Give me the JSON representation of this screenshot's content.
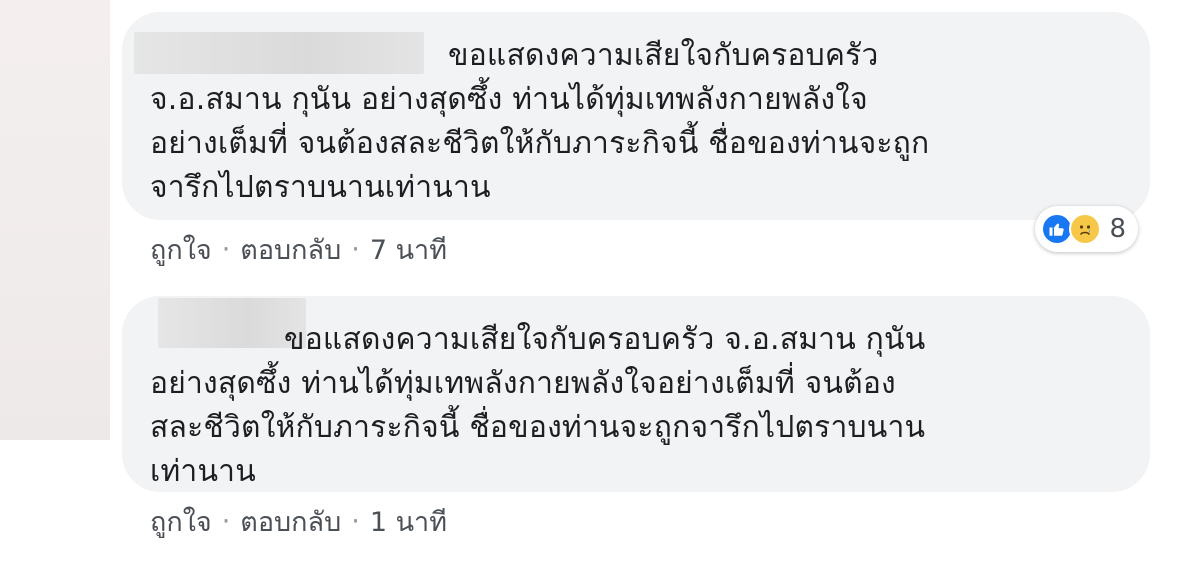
{
  "comments": [
    {
      "author": "",
      "lines": [
        "ขอแสดงความเสียใจกับครอบครัว",
        "จ.อ.สมาน กุนัน อย่างสุดซึ้ง ท่านได้ทุ่มเทพลังกายพลังใจ",
        "อย่างเต็มที่ จนต้องสละชีวิตให้กับภาระกิจนี้ ชื่อของท่านจะถูก",
        "จารึกไปตราบนานเท่านาน"
      ],
      "actions": {
        "like": "ถูกใจ",
        "reply": "ตอบกลับ",
        "separator": "·",
        "time": "7 นาที"
      },
      "reactions": {
        "icons": [
          "like-icon",
          "sad-icon"
        ],
        "count": "8"
      }
    },
    {
      "author": "",
      "lines": [
        "ขอแสดงความเสียใจกับครอบครัว จ.อ.สมาน กุนัน",
        "อย่างสุดซึ้ง ท่านได้ทุ่มเทพลังกายพลังใจอย่างเต็มที่ จนต้อง",
        "สละชีวิตให้กับภาระกิจนี้ ชื่อของท่านจะถูกจารึกไปตราบนาน",
        "เท่านาน"
      ],
      "actions": {
        "like": "ถูกใจ",
        "reply": "ตอบกลับ",
        "separator": "·",
        "time": "1 นาที"
      }
    }
  ],
  "colors": {
    "bubble": "#f2f3f5",
    "text": "#1c1e21",
    "meta": "#4b4f56",
    "like": "#1877f2",
    "sad": "#f7c748"
  }
}
